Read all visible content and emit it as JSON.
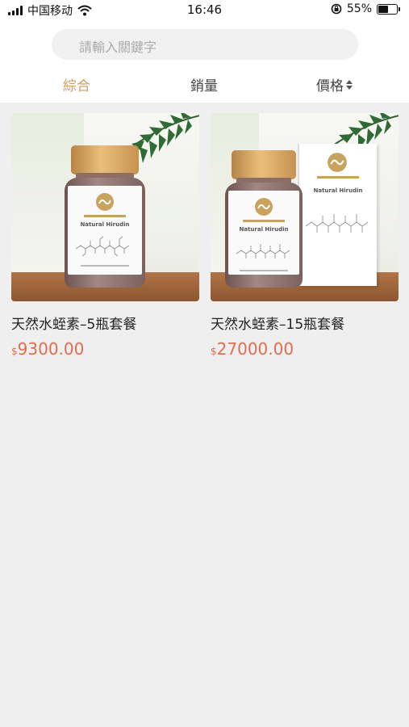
{
  "status_bar": {
    "carrier": "中国移动",
    "time": "16:46",
    "battery": "55%",
    "battery_level": 0.55
  },
  "search": {
    "placeholder": "請輸入關鍵字"
  },
  "sort_tabs": [
    {
      "label": "綜合",
      "active": true
    },
    {
      "label": "銷量",
      "active": false
    },
    {
      "label": "價格",
      "active": false
    }
  ],
  "products": [
    {
      "title": "天然水蛭素–5瓶套餐",
      "currency": "$",
      "price": "9300.00",
      "label_text": "Natural Hirudin",
      "image_icons": [
        "bottle-icon",
        "palm-leaf-icon"
      ]
    },
    {
      "title": "天然水蛭素–15瓶套餐",
      "currency": "$",
      "price": "27000.00",
      "label_text": "Natural Hirudin",
      "box_label_text": "Natural Hirudin",
      "image_icons": [
        "bottle-icon",
        "box-icon",
        "palm-leaf-icon"
      ]
    }
  ],
  "colors": {
    "accent": "#d79a5b",
    "price": "#e06d4f",
    "background": "#efefef"
  }
}
